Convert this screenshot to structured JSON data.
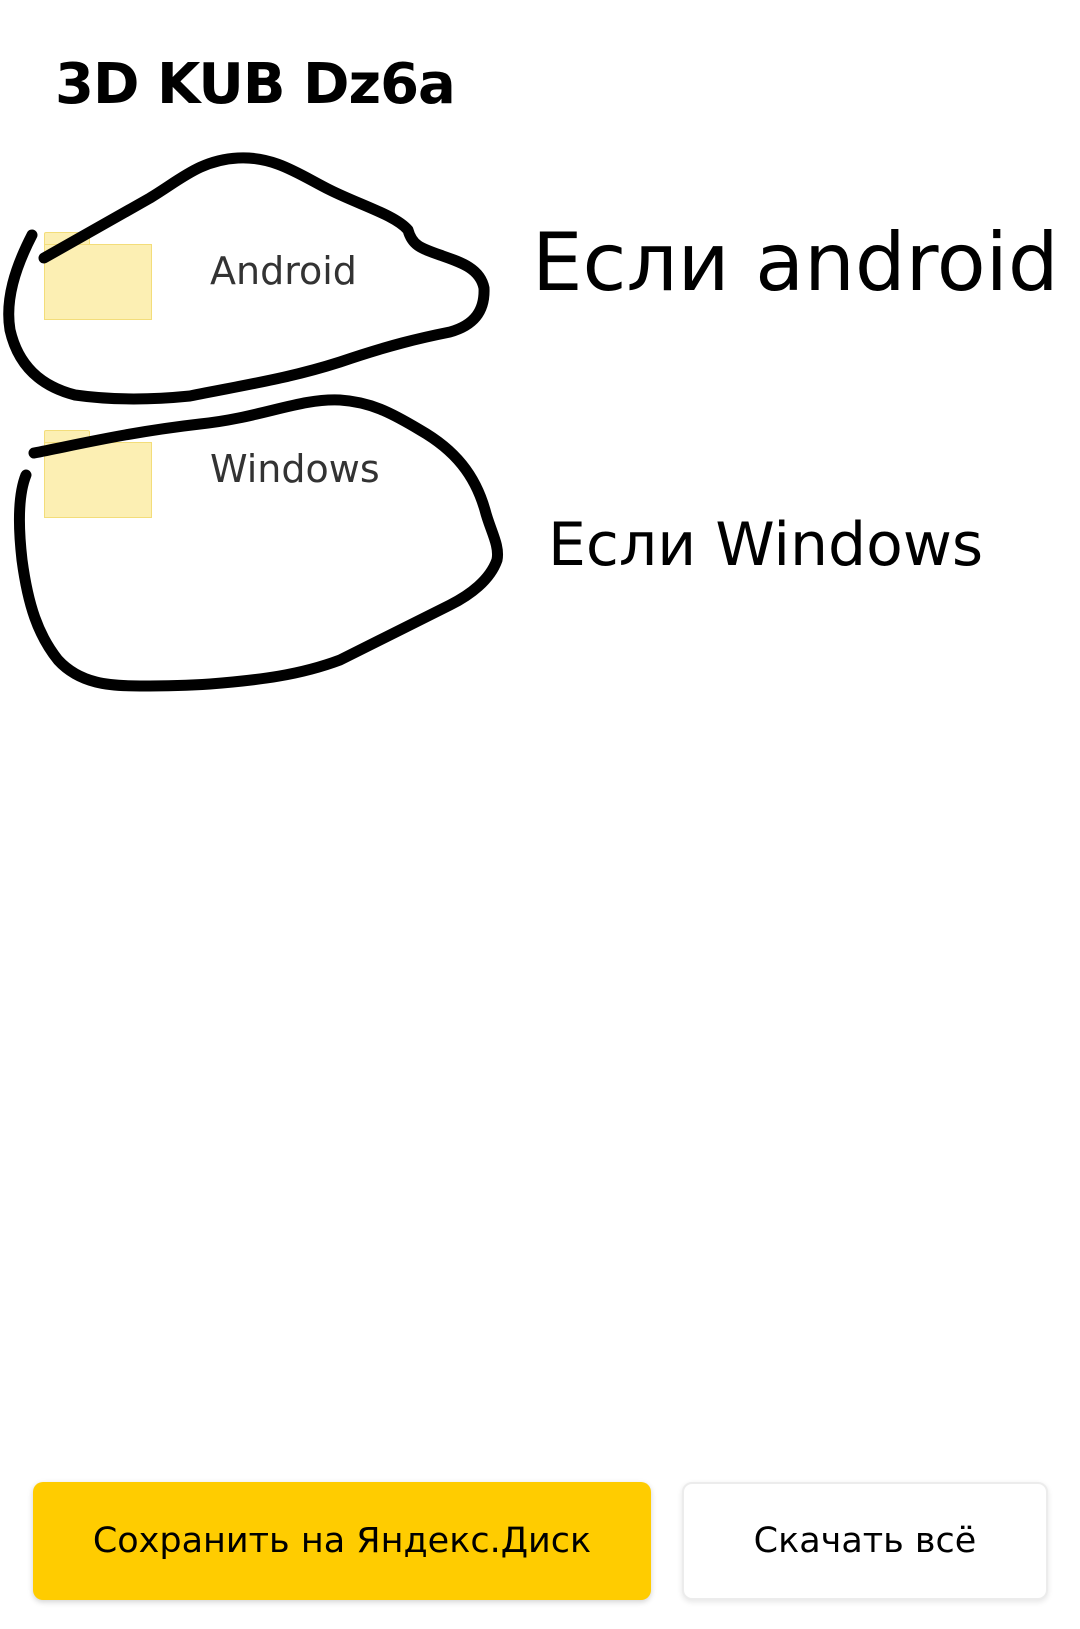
{
  "page": {
    "title": "3D KUB Dz6a"
  },
  "folders": [
    {
      "name": "Android",
      "icon": "folder-icon"
    },
    {
      "name": "Windows",
      "icon": "folder-icon"
    }
  ],
  "annotations": {
    "android_note": "Если android",
    "windows_note": "Если Windows"
  },
  "actions": {
    "save_label": "Сохранить на Яндекс.Диск",
    "download_label": "Скачать всё"
  },
  "colors": {
    "accent": "#ffcc00",
    "folder_fill": "#fcefb3",
    "folder_border": "#f3dd7a",
    "scribble": "#000000"
  }
}
